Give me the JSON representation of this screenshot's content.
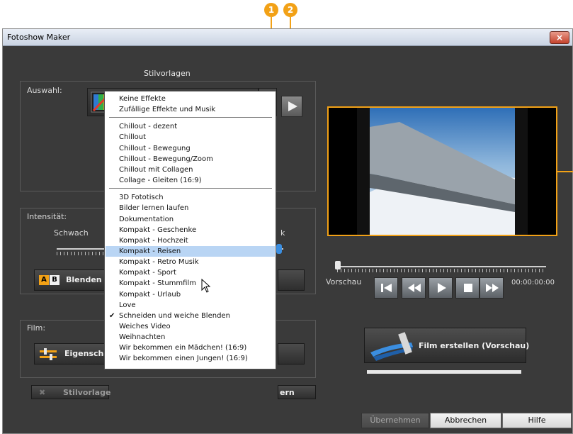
{
  "callouts": [
    "1",
    "2"
  ],
  "window": {
    "title": "Fotoshow Maker",
    "close_glyph": "×"
  },
  "styles": {
    "heading": "Stilvorlagen",
    "selection_label": "Auswahl:",
    "current_style": "Schneiden und weiche Blenden",
    "dropdown_icon": "triangle-down-icon",
    "play_icon": "play-icon"
  },
  "dropdown": {
    "groups": [
      [
        "Keine Effekte",
        "Zufällige Effekte und Musik"
      ],
      [
        "Chillout - dezent",
        "Chillout",
        "Chillout - Bewegung",
        "Chillout - Bewegung/Zoom",
        "Chillout mit Collagen",
        "Collage - Gleiten (16:9)"
      ],
      [
        "3D Fototisch",
        "Bilder lernen laufen",
        "Dokumentation",
        "Kompakt - Geschenke",
        "Kompakt - Hochzeit",
        "Kompakt - Reisen",
        "Kompakt - Retro Musik",
        "Kompakt - Sport",
        "Kompakt - Stummfilm",
        "Kompakt - Urlaub",
        "Love",
        "Schneiden und weiche Blenden",
        "Weiches Video",
        "Weihnachten",
        "Wir bekommen ein Mädchen! (16:9)",
        "Wir bekommen einen Jungen! (16:9)"
      ]
    ],
    "highlighted": "Kompakt - Reisen",
    "checked": "Schneiden und weiche Blenden",
    "check_glyph": "✔"
  },
  "intensity": {
    "label": "Intensität:",
    "weak_label": "Schwach",
    "strong_label_fragment": "k",
    "blend_button": "Blenden",
    "blend_icon_letters": [
      "A",
      "B"
    ]
  },
  "film": {
    "label": "Film:",
    "properties_button": "Eigenschaf",
    "templates_button": "Stilvorlage",
    "save_button_fragment": "ern"
  },
  "preview": {
    "label": "Vorschau",
    "time": "00:00:00:00",
    "progress": 0.0
  },
  "create": {
    "button": "Film erstellen (Vorschau)",
    "progress": 0.0
  },
  "footer": {
    "apply": "Übernehmen",
    "cancel": "Abbrechen",
    "help": "Hilfe"
  },
  "colors": {
    "accent": "#f2a116",
    "panel": "#3a3a3a",
    "highlight": "#b9d5f4"
  }
}
